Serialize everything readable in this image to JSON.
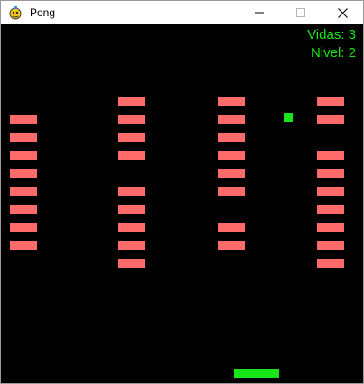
{
  "window": {
    "title": "Pong",
    "icon": "pygame-snake-icon",
    "controls": [
      "minimize-icon",
      "maximize-icon",
      "close-icon"
    ]
  },
  "hud": {
    "lives_text": "Vidas: 3",
    "level_text": "Nivel: 2"
  },
  "game": {
    "lives": 3,
    "level": 2,
    "brick_columns": [
      {
        "name": "column-1",
        "slots_filled": [
          false,
          true,
          true,
          true,
          true,
          true,
          true,
          true,
          true,
          false
        ]
      },
      {
        "name": "column-2",
        "slots_filled": [
          true,
          true,
          true,
          true,
          false,
          true,
          true,
          true,
          true,
          true
        ]
      },
      {
        "name": "column-3",
        "slots_filled": [
          true,
          true,
          true,
          true,
          true,
          true,
          false,
          true,
          true,
          false
        ]
      },
      {
        "name": "column-4",
        "slots_filled": [
          true,
          true,
          false,
          true,
          true,
          true,
          true,
          true,
          true,
          true
        ]
      }
    ]
  },
  "colors": {
    "background": "#000000",
    "brick": "#ff6a6a",
    "ball": "#19e619",
    "paddle": "#19e619",
    "hud_text": "#19e619"
  }
}
